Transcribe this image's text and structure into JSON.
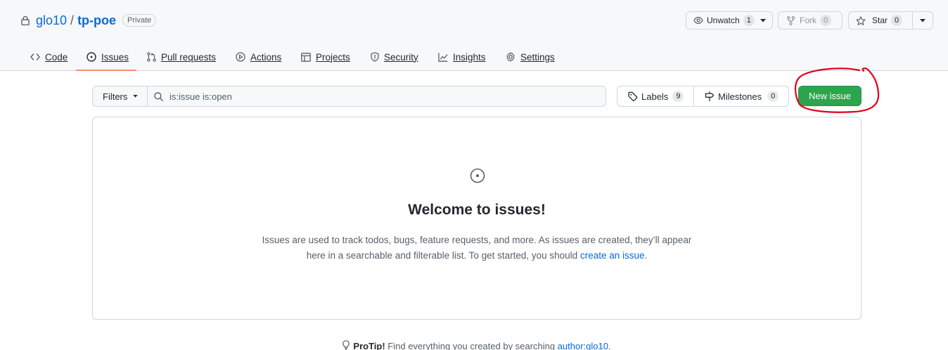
{
  "repo": {
    "owner": "glo10",
    "separator": "/",
    "name": "tp-poe",
    "visibility": "Private"
  },
  "actions": {
    "unwatch_label": "Unwatch",
    "unwatch_count": "1",
    "fork_label": "Fork",
    "fork_count": "0",
    "star_label": "Star",
    "star_count": "0"
  },
  "tabs": [
    {
      "label": "Code",
      "icon": "code-icon"
    },
    {
      "label": "Issues",
      "icon": "issue-opened-icon",
      "selected": true
    },
    {
      "label": "Pull requests",
      "icon": "git-pull-request-icon"
    },
    {
      "label": "Actions",
      "icon": "play-icon"
    },
    {
      "label": "Projects",
      "icon": "table-icon"
    },
    {
      "label": "Security",
      "icon": "shield-icon"
    },
    {
      "label": "Insights",
      "icon": "graph-icon"
    },
    {
      "label": "Settings",
      "icon": "gear-icon"
    }
  ],
  "issues": {
    "filters_label": "Filters",
    "search_value": "is:issue is:open",
    "labels_label": "Labels",
    "labels_count": "9",
    "milestones_label": "Milestones",
    "milestones_count": "0",
    "new_issue_label": "New issue"
  },
  "blankslate": {
    "title": "Welcome to issues!",
    "text_before": "Issues are used to track todos, bugs, feature requests, and more. As issues are created, they’ll appear here in a searchable and filterable list. To get started, you should ",
    "link_text": "create an issue",
    "text_after": "."
  },
  "protip": {
    "bold": "ProTip!",
    "text": " Find everything you created by searching ",
    "link": "author:glo10",
    "end": "."
  },
  "colors": {
    "primary_button": "#2da44e",
    "link": "#0969da",
    "selected_tab_underline": "#fd8c73",
    "annotation": "#e0001b"
  }
}
